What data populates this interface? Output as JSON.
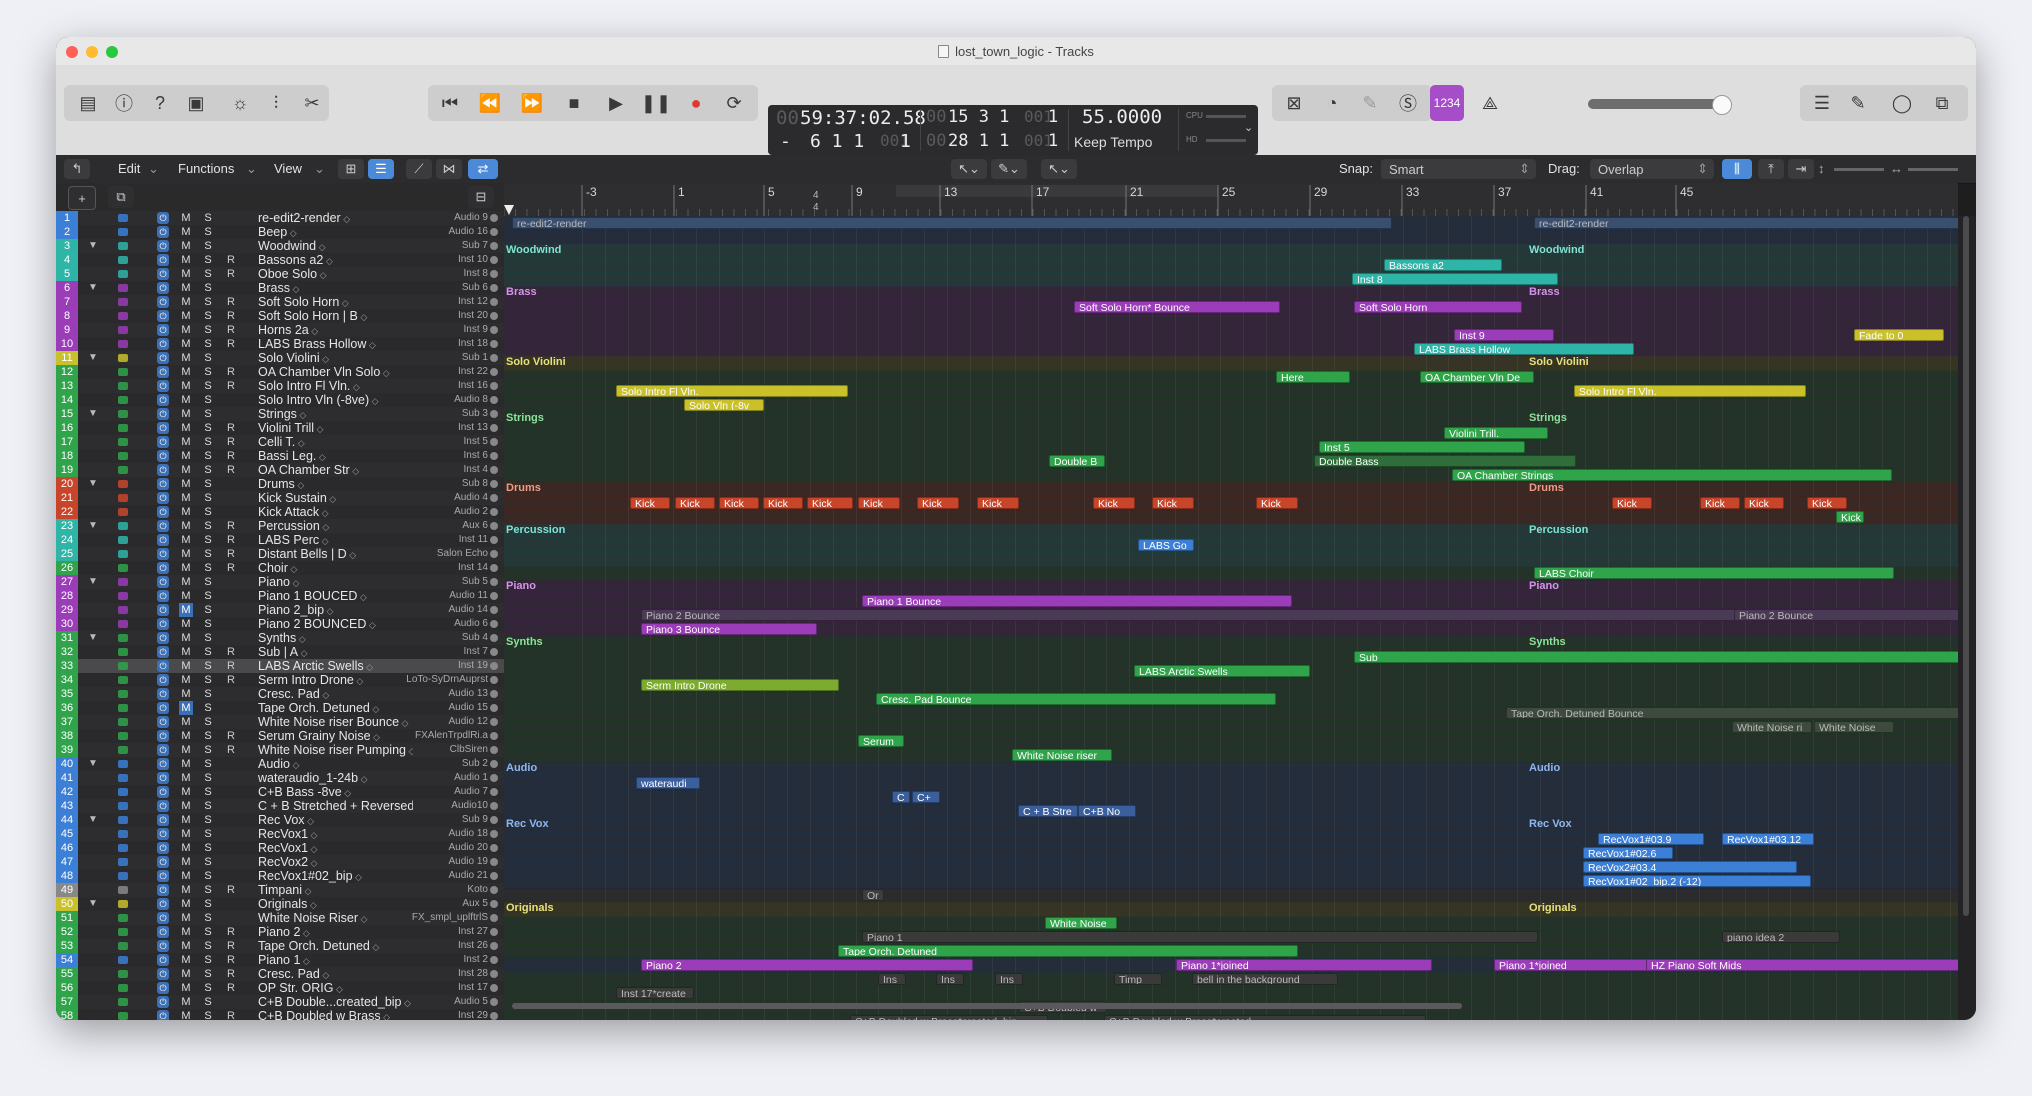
{
  "window": {
    "title": "lost_town_logic - Tracks"
  },
  "lcd": {
    "time_dim": "00",
    "time": "59:37:02.58",
    "bar_dim": "00",
    "bar": "15  3  1",
    "bar_dim2": "001",
    "bar_end": "1",
    "minus": "-",
    "pos2": "6  1  1",
    "pos2_dim": "001",
    "pos2_end": "1",
    "bar2_dim": "00",
    "bar2": "28  1  1",
    "bar2_dim2": "001",
    "bar2_end": "1",
    "tempo": "55.0000",
    "mode": "Keep Tempo",
    "cpu_label": "CPU",
    "hd_label": "HD"
  },
  "toolbar": {
    "lcd_badge": "1234"
  },
  "controlbar": {
    "edit": "Edit",
    "functions": "Functions",
    "view": "View",
    "snap_label": "Snap:",
    "snap_value": "Smart",
    "drag_label": "Drag:",
    "drag_value": "Overlap"
  },
  "ruler": {
    "marks": [
      "-3",
      "1",
      "5",
      "9",
      "13",
      "17",
      "21",
      "25",
      "29",
      "33",
      "37",
      "41",
      "45"
    ],
    "sub": [
      "4",
      "4"
    ]
  },
  "tracks": [
    {
      "n": "1",
      "name": "re-edit2-render",
      "out": "Audio 9",
      "color": "#3b7fd6",
      "arrow": "",
      "r": false
    },
    {
      "n": "2",
      "name": "Beep",
      "out": "Audio 16",
      "color": "#3b7fd6",
      "arrow": "",
      "r": false
    },
    {
      "n": "3",
      "name": "Woodwind",
      "out": "Sub 7",
      "color": "#2fb5a8",
      "arrow": "▼",
      "r": false
    },
    {
      "n": "4",
      "name": "Bassons a2",
      "out": "Inst 10",
      "color": "#2fb5a8",
      "arrow": "",
      "r": true
    },
    {
      "n": "5",
      "name": "Oboe Solo",
      "out": "Inst 8",
      "color": "#2fb5a8",
      "arrow": "",
      "r": true
    },
    {
      "n": "6",
      "name": "Brass",
      "out": "Sub 6",
      "color": "#9b3cb8",
      "arrow": "▼",
      "r": false
    },
    {
      "n": "7",
      "name": "Soft Solo Horn",
      "out": "Inst 12",
      "color": "#9b3cb8",
      "arrow": "",
      "r": true
    },
    {
      "n": "8",
      "name": "Soft Solo Horn | B",
      "out": "Inst 20",
      "color": "#9b3cb8",
      "arrow": "",
      "r": true
    },
    {
      "n": "9",
      "name": "Horns 2a",
      "out": "Inst 9",
      "color": "#9b3cb8",
      "arrow": "",
      "r": true
    },
    {
      "n": "10",
      "name": "LABS Brass Hollow",
      "out": "Inst 18",
      "color": "#9b3cb8",
      "arrow": "",
      "r": true
    },
    {
      "n": "11",
      "name": "Solo Violini",
      "out": "Sub 1",
      "color": "#c9c02a",
      "arrow": "▼",
      "r": false
    },
    {
      "n": "12",
      "name": "OA Chamber Vln Solo",
      "out": "Inst 22",
      "color": "#2fa44a",
      "arrow": "",
      "r": true
    },
    {
      "n": "13",
      "name": "Solo Intro Fl Vln.",
      "out": "Inst 16",
      "color": "#2fa44a",
      "arrow": "",
      "r": true
    },
    {
      "n": "14",
      "name": "Solo Intro Vln (-8ve)",
      "out": "Audio 8",
      "color": "#2fa44a",
      "arrow": "",
      "r": false
    },
    {
      "n": "15",
      "name": "Strings",
      "out": "Sub 3",
      "color": "#2fa44a",
      "arrow": "▼",
      "r": false
    },
    {
      "n": "16",
      "name": "Violini Trill",
      "out": "Inst 13",
      "color": "#2fa44a",
      "arrow": "",
      "r": true
    },
    {
      "n": "17",
      "name": "Celli T.",
      "out": "Inst 5",
      "color": "#2fa44a",
      "arrow": "",
      "r": true
    },
    {
      "n": "18",
      "name": "Bassi Leg.",
      "out": "Inst 6",
      "color": "#2fa44a",
      "arrow": "",
      "r": true
    },
    {
      "n": "19",
      "name": "OA Chamber Str",
      "out": "Inst 4",
      "color": "#2fa44a",
      "arrow": "",
      "r": true
    },
    {
      "n": "20",
      "name": "Drums",
      "out": "Sub 8",
      "color": "#c8452a",
      "arrow": "▼",
      "r": false
    },
    {
      "n": "21",
      "name": "Kick Sustain",
      "out": "Audio 4",
      "color": "#c8452a",
      "arrow": "",
      "r": false
    },
    {
      "n": "22",
      "name": "Kick Attack",
      "out": "Audio 2",
      "color": "#c8452a",
      "arrow": "",
      "r": false
    },
    {
      "n": "23",
      "name": "Percussion",
      "out": "Aux 6",
      "color": "#2fb5a8",
      "arrow": "▼",
      "r": true
    },
    {
      "n": "24",
      "name": "LABS Perc",
      "out": "Inst 11",
      "color": "#2fb5a8",
      "arrow": "",
      "r": true
    },
    {
      "n": "25",
      "name": "Distant Bells | D",
      "out": "Salon Echo",
      "color": "#2fb5a8",
      "arrow": "",
      "r": true
    },
    {
      "n": "26",
      "name": "Choir",
      "out": "Inst 14",
      "color": "#2fa44a",
      "arrow": "",
      "r": true
    },
    {
      "n": "27",
      "name": "Piano",
      "out": "Sub 5",
      "color": "#9b3cb8",
      "arrow": "▼",
      "r": false
    },
    {
      "n": "28",
      "name": "Piano 1 BOUCED",
      "out": "Audio 11",
      "color": "#9b3cb8",
      "arrow": "",
      "r": false
    },
    {
      "n": "29",
      "name": "Piano 2_bip",
      "out": "Audio 14",
      "color": "#9b3cb8",
      "arrow": "",
      "r": false
    },
    {
      "n": "30",
      "name": "Piano 2 BOUNCED",
      "out": "Audio 6",
      "color": "#9b3cb8",
      "arrow": "",
      "r": false
    },
    {
      "n": "31",
      "name": "Synths",
      "out": "Sub 4",
      "color": "#2fa44a",
      "arrow": "▼",
      "r": false
    },
    {
      "n": "32",
      "name": "Sub | A",
      "out": "Inst 7",
      "color": "#2fa44a",
      "arrow": "",
      "r": true
    },
    {
      "n": "33",
      "name": "LABS Arctic Swells",
      "out": "Inst 19",
      "color": "#2fa44a",
      "arrow": "",
      "r": true
    },
    {
      "n": "34",
      "name": "Serm Intro Drone",
      "out": "LoTo-SyDrnAuprst",
      "color": "#2fa44a",
      "arrow": "",
      "r": true
    },
    {
      "n": "35",
      "name": "Cresc. Pad",
      "out": "Audio 13",
      "color": "#2fa44a",
      "arrow": "",
      "r": false
    },
    {
      "n": "36",
      "name": "Tape Orch. Detuned",
      "out": "Audio 15",
      "color": "#2fa44a",
      "arrow": "",
      "r": false
    },
    {
      "n": "37",
      "name": "White Noise riser Bounce",
      "out": "Audio 12",
      "color": "#2fa44a",
      "arrow": "",
      "r": false
    },
    {
      "n": "38",
      "name": "Serum Grainy Noise",
      "out": "FXAlenTrpdlRi.a",
      "color": "#2fa44a",
      "arrow": "",
      "r": true
    },
    {
      "n": "39",
      "name": "White Noise riser Pumping",
      "out": "ClbSiren",
      "color": "#2fa44a",
      "arrow": "",
      "r": true
    },
    {
      "n": "40",
      "name": "Audio",
      "out": "Sub 2",
      "color": "#3b7fd6",
      "arrow": "▼",
      "r": false
    },
    {
      "n": "41",
      "name": "wateraudio_1-24b",
      "out": "Audio 1",
      "color": "#3b7fd6",
      "arrow": "",
      "r": false
    },
    {
      "n": "42",
      "name": "C+B Bass -8ve",
      "out": "Audio 7",
      "color": "#3b7fd6",
      "arrow": "",
      "r": false
    },
    {
      "n": "43",
      "name": "C + B Stretched + Reversed",
      "out": "Audio10",
      "color": "#3b7fd6",
      "arrow": "",
      "r": false
    },
    {
      "n": "44",
      "name": "Rec Vox",
      "out": "Sub 9",
      "color": "#3b7fd6",
      "arrow": "▼",
      "r": false
    },
    {
      "n": "45",
      "name": "RecVox1",
      "out": "Audio 18",
      "color": "#3b7fd6",
      "arrow": "",
      "r": false
    },
    {
      "n": "46",
      "name": "RecVox1",
      "out": "Audio 20",
      "color": "#3b7fd6",
      "arrow": "",
      "r": false
    },
    {
      "n": "47",
      "name": "RecVox2",
      "out": "Audio 19",
      "color": "#3b7fd6",
      "arrow": "",
      "r": false
    },
    {
      "n": "48",
      "name": "RecVox1#02_bip",
      "out": "Audio 21",
      "color": "#3b7fd6",
      "arrow": "",
      "r": false
    },
    {
      "n": "49",
      "name": "Timpani",
      "out": "Koto",
      "color": "#888888",
      "arrow": "",
      "r": true
    },
    {
      "n": "50",
      "name": "Originals",
      "out": "Aux 5",
      "color": "#c9c02a",
      "arrow": "▼",
      "r": false
    },
    {
      "n": "51",
      "name": "White Noise Riser",
      "out": "FX_smpl_uplftrlS",
      "color": "#2fa44a",
      "arrow": "",
      "r": false
    },
    {
      "n": "52",
      "name": "Piano 2",
      "out": "Inst 27",
      "color": "#2fa44a",
      "arrow": "",
      "r": true
    },
    {
      "n": "53",
      "name": "Tape Orch. Detuned",
      "out": "Inst 26",
      "color": "#2fa44a",
      "arrow": "",
      "r": true
    },
    {
      "n": "54",
      "name": "Piano 1",
      "out": "Inst 2",
      "color": "#3b7fd6",
      "arrow": "",
      "r": true
    },
    {
      "n": "55",
      "name": "Cresc. Pad",
      "out": "Inst 28",
      "color": "#2fa44a",
      "arrow": "",
      "r": true
    },
    {
      "n": "56",
      "name": "OP Str. ORIG",
      "out": "Inst 17",
      "color": "#2fa44a",
      "arrow": "",
      "r": true
    },
    {
      "n": "57",
      "name": "C+B Double...created_bip",
      "out": "Audio 5",
      "color": "#2fa44a",
      "arrow": "",
      "r": false
    },
    {
      "n": "58",
      "name": "C+B Doubled w Brass",
      "out": "Inst 29",
      "color": "#2fa44a",
      "arrow": "",
      "r": true
    }
  ],
  "folder_labels": [
    {
      "text": "Woodwind",
      "color": "#7fe3d7"
    },
    {
      "text": "Brass",
      "color": "#d594ea"
    },
    {
      "text": "Solo Violini",
      "color": "#e8e07a"
    },
    {
      "text": "Strings",
      "color": "#8de39a"
    },
    {
      "text": "Drums",
      "color": "#f09a82"
    },
    {
      "text": "Percussion",
      "color": "#7fe3d7"
    },
    {
      "text": "Piano",
      "color": "#d594ea"
    },
    {
      "text": "Synths",
      "color": "#8de39a"
    },
    {
      "text": "Audio",
      "color": "#8fb7ef"
    },
    {
      "text": "Rec Vox",
      "color": "#8fb7ef"
    },
    {
      "text": "Originals",
      "color": "#e8e07a"
    }
  ],
  "regions": [
    {
      "label": "re-edit2-render",
      "row": 0
    },
    {
      "label": "re-edit2-render",
      "row": 0
    },
    {
      "label": "Bassons a2",
      "row": 3
    },
    {
      "label": "Inst 8",
      "row": 4
    },
    {
      "label": "Soft Solo Horn* Bounce",
      "row": 6
    },
    {
      "label": "Soft Solo Horn",
      "row": 6
    },
    {
      "label": "Inst 9",
      "row": 8
    },
    {
      "label": "Fade to 0",
      "row": 8
    },
    {
      "label": "LABS Brass Hollow",
      "row": 9
    },
    {
      "label": "Here",
      "row": 11
    },
    {
      "label": "OA Chamber Vln De",
      "row": 11
    },
    {
      "label": "Solo Intro Fl Vln.",
      "row": 12
    },
    {
      "label": "Solo Intro Fl Vln.",
      "row": 12
    },
    {
      "label": "Solo Vln (-8v",
      "row": 13
    },
    {
      "label": "Violini Trill.",
      "row": 15
    },
    {
      "label": "Inst 5",
      "row": 16
    },
    {
      "label": "Double B",
      "row": 17
    },
    {
      "label": "Double Bass",
      "row": 17
    },
    {
      "label": "OA Chamber Strings",
      "row": 18
    },
    {
      "label": "Kick",
      "row": 20
    },
    {
      "label": "Kick",
      "row": 20
    },
    {
      "label": "Kick",
      "row": 20
    },
    {
      "label": "Kick",
      "row": 20
    },
    {
      "label": "Kick",
      "row": 20
    },
    {
      "label": "Kick",
      "row": 20
    },
    {
      "label": "Kick",
      "row": 20
    },
    {
      "label": "Kick",
      "row": 20
    },
    {
      "label": "Kick",
      "row": 20
    },
    {
      "label": "Kick",
      "row": 20
    },
    {
      "label": "Kick",
      "row": 20
    },
    {
      "label": "Kick",
      "row": 20
    },
    {
      "label": "Kick",
      "row": 20
    },
    {
      "label": "Kick",
      "row": 20
    },
    {
      "label": "Kick",
      "row": 20
    },
    {
      "label": "Kick",
      "row": 21
    },
    {
      "label": "LABS Go",
      "row": 23
    },
    {
      "label": "LABS Choir",
      "row": 25
    },
    {
      "label": "Piano 1 Bounce",
      "row": 27
    },
    {
      "label": "Piano 2 Bounce",
      "row": 28
    },
    {
      "label": "Piano 2 Bounce",
      "row": 28
    },
    {
      "label": "Piano 3 Bounce",
      "row": 29
    },
    {
      "label": "Sub",
      "row": 31
    },
    {
      "label": "LABS Arctic Swells",
      "row": 32
    },
    {
      "label": "Serm Intro Drone",
      "row": 33
    },
    {
      "label": "Cresc. Pad Bounce",
      "row": 34
    },
    {
      "label": "Tape Orch. Detuned Bounce",
      "row": 35
    },
    {
      "label": "White Noise ri",
      "row": 36
    },
    {
      "label": "White Noise",
      "row": 36
    },
    {
      "label": "Serum",
      "row": 37
    },
    {
      "label": "White Noise riser",
      "row": 38
    },
    {
      "label": "wateraudi",
      "row": 40
    },
    {
      "label": "C",
      "row": 41
    },
    {
      "label": "C+",
      "row": 41
    },
    {
      "label": "C + B Stre",
      "row": 42
    },
    {
      "label": "C+B No",
      "row": 42
    },
    {
      "label": "RecVox1#03.9",
      "row": 44
    },
    {
      "label": "RecVox1#03.12",
      "row": 44
    },
    {
      "label": "RecVox1#02.6",
      "row": 45
    },
    {
      "label": "RecVox2#03.4",
      "row": 46
    },
    {
      "label": "RecVox1#02_bip.2 (-12)",
      "row": 47
    },
    {
      "label": "Or",
      "row": 48
    },
    {
      "label": "White Noise",
      "row": 50
    },
    {
      "label": "Piano 1",
      "row": 51
    },
    {
      "label": "piano idea 2",
      "row": 51
    },
    {
      "label": "Tape Orch. Detuned",
      "row": 52
    },
    {
      "label": "Piano 2",
      "row": 53
    },
    {
      "label": "Piano 1*joined",
      "row": 53
    },
    {
      "label": "Piano 1*joined",
      "row": 53
    },
    {
      "label": "HZ Piano Soft Mids",
      "row": 53
    },
    {
      "label": "Ins",
      "row": 54
    },
    {
      "label": "Ins",
      "row": 54
    },
    {
      "label": "Ins",
      "row": 54
    },
    {
      "label": "Timp",
      "row": 54
    },
    {
      "label": "bell in the background",
      "row": 54
    },
    {
      "label": "Inst 17*create",
      "row": 55
    },
    {
      "label": "C+B Doubled w",
      "row": 56
    },
    {
      "label": "C+B Doubled w Brass*created_bip",
      "row": 57
    },
    {
      "label": "C+B Doubled w Brass*created",
      "row": 57
    }
  ]
}
